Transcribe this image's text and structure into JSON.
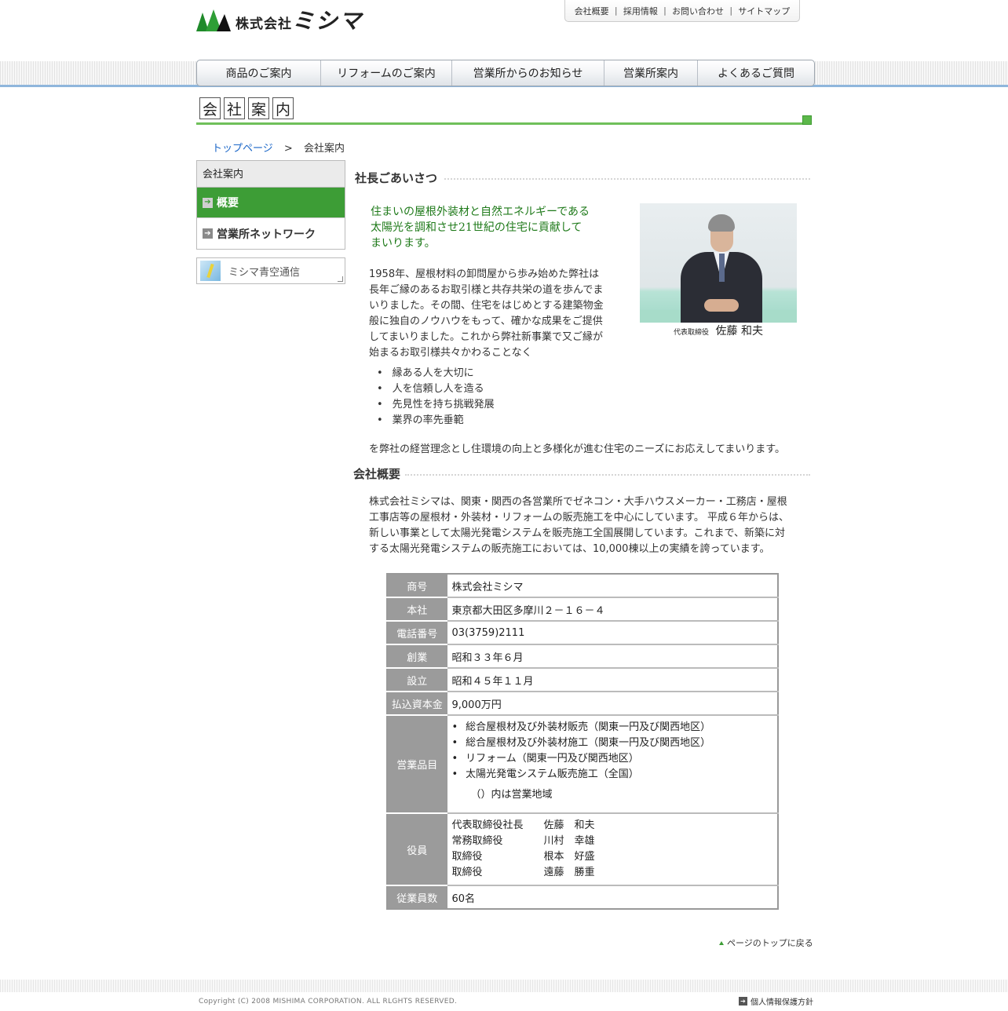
{
  "header": {
    "logo_small": "株式会社",
    "logo_big": "ミシマ",
    "top_links": [
      "会社概要",
      "採用情報",
      "お問い合わせ",
      "サイトマップ"
    ],
    "nav": [
      "商品のご案内",
      "リフォームのご案内",
      "営業所からのお知らせ",
      "営業所案内",
      "よくあるご質問"
    ]
  },
  "page_title_chars": [
    "会",
    "社",
    "案",
    "内"
  ],
  "breadcrumb": {
    "home": "トップページ",
    "sep": ">",
    "current": "会社案内"
  },
  "sidebar": {
    "head": "会社案内",
    "items": [
      {
        "label": "概要",
        "active": true
      },
      {
        "label": "営業所ネットワーク",
        "active": false
      }
    ],
    "banner": "ミシマ青空通信"
  },
  "greeting": {
    "title": "社長ごあいさつ",
    "lead": [
      "住まいの屋根外装材と自然エネルギーである",
      "太陽光を調和させ21世紀の住宅に貢献して",
      "まいります。"
    ],
    "body": [
      "1958年、屋根材料の卸問屋から歩み始めた弊社は",
      "長年ご縁のあるお取引様と共存共栄の道を歩んでま",
      "いりました。その間、住宅をはじめとする建築物金",
      "般に独自のノウハウをもって、確かな成果をご提供",
      "してまいりました。これから弊社新事業で又ご縁が",
      "始まるお取引様共々かわることなく"
    ],
    "list": [
      "縁ある人を大切に",
      "人を信頼し人を造る",
      "先見性を持ち挑戦発展",
      "業界の率先垂範"
    ],
    "tail": "を弊社の経営理念とし住環境の向上と多様化が進む住宅のニーズにお応えしてまいります。",
    "caption_role": "代表取締役",
    "caption_name": "佐藤 和夫"
  },
  "overview": {
    "title": "会社概要",
    "text": [
      "株式会社ミシマは、関東・関西の各営業所でゼネコン・大手ハウスメーカー・工務店・屋根",
      "工事店等の屋根材・外装材・リフォームの販売施工を中心にしています。 平成６年からは、",
      "新しい事業として太陽光発電システムを販売施工全国展開しています。これまで、新築に対",
      "する太陽光発電システムの販売施工においては、10,000棟以上の実績を誇っています。"
    ]
  },
  "table": {
    "rows": [
      {
        "label": "商号",
        "value": "株式会社ミシマ"
      },
      {
        "label": "本社",
        "value": "東京都大田区多摩川２－１６－４"
      },
      {
        "label": "電話番号",
        "value": "03(3759)2111"
      },
      {
        "label": "創業",
        "value": "昭和３３年６月"
      },
      {
        "label": "設立",
        "value": "昭和４５年１１月"
      },
      {
        "label": "払込資本金",
        "value": "9,000万円"
      }
    ],
    "business_label": "営業品目",
    "business_items": [
      "総合屋根材及び外装材販売（関東一円及び関西地区）",
      "総合屋根材及び外装材施工（関東一円及び関西地区）",
      "リフォーム（関東一円及び関西地区）",
      "太陽光発電システム販売施工（全国）"
    ],
    "business_note": "（）内は営業地域",
    "officers_label": "役員",
    "officers": [
      {
        "pos": "代表取締役社長",
        "name": "佐藤　和夫"
      },
      {
        "pos": "常務取締役",
        "name": "川村　幸雄"
      },
      {
        "pos": "取締役",
        "name": "根本　好盛"
      },
      {
        "pos": "取締役",
        "name": "遠藤　勝重"
      }
    ],
    "employees_label": "従業員数",
    "employees_value": "60名"
  },
  "back_to_top": "ページのトップに戻る",
  "footer": {
    "copyright": "Copyright (C) 2008 MISHIMA CORPORATION. ALL RLGHTS RESERVED.",
    "privacy": "個人情報保護方針"
  },
  "colors": {
    "accent_green": "#3d9d36",
    "lead_green": "#1f7a1a",
    "table_header": "#9b9b9b"
  }
}
